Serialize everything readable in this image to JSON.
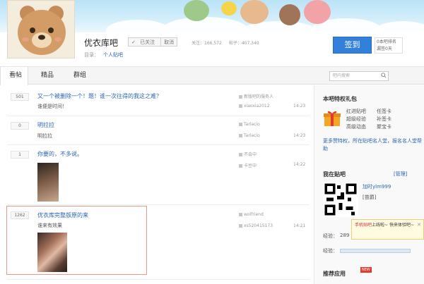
{
  "forum": {
    "title": "优衣库吧",
    "follow_label": "已关注",
    "unfollow_label": "取消",
    "stats": {
      "follow": "关注：166,572",
      "posts": "帖子：407,340"
    },
    "category": "目录：",
    "category_link": "个人贴吧",
    "sign_label": "签到",
    "sign_info": [
      "0本吧排名",
      "漏签0天"
    ]
  },
  "tabs": [
    {
      "label": "看帖"
    },
    {
      "label": "精品"
    },
    {
      "label": "群组"
    }
  ],
  "search": {
    "placeholder": "吧内搜索"
  },
  "threads": [
    {
      "replies": "501",
      "title": "又一个被删除一个！题！谁一次往得的我这之难？",
      "abstract": "谁便是时间！",
      "author": "新版吧的服务人",
      "last": "xiaoxia2012",
      "time": "14:23"
    },
    {
      "replies": "0",
      "title": "明拉拉",
      "abstract": "明拉拉",
      "author": "Tarlacio",
      "last": "Tarlacio",
      "time": "14:23"
    },
    {
      "replies": "1",
      "title": "你要的，不多说。",
      "abstract": "",
      "author": "不会中",
      "last": "卡豆中",
      "time": "14:22"
    },
    {
      "replies": "1262",
      "title": "优衣库完整版原的来",
      "abstract": "谁来有效果",
      "author": "wolfriend",
      "last": "xs520415173",
      "time": "14:21"
    }
  ],
  "sidebar": {
    "privilege_title": "本吧特权礼包",
    "privileges": [
      "红进贴吧",
      "任签卡",
      "超级经验",
      "补签卡",
      "高级动态",
      "聚宝卡"
    ],
    "privilege_desc": "更多赞特权，所在贴吧名人堂，报名名人堂帮助",
    "my_forum_title": "我在贴吧",
    "my_forum_link": "[管理]",
    "username": "加时ylm999",
    "username_sub": "[苗爵]",
    "level_label": "经验：",
    "level_value": "289",
    "exp_label": "经验：",
    "tooltip_prefix": "手机贴吧内",
    "tooltip_highlight": "手机贴吧",
    "tooltip_text": "上线啦~ 快来体验吧~",
    "app_title": "推荐应用",
    "new_badge": "NEW"
  }
}
